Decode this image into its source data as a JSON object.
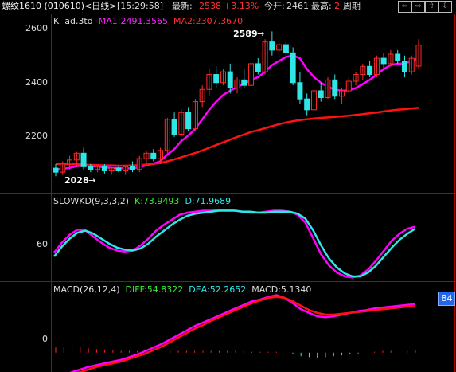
{
  "topbar": {
    "title": "螺纹1610 (010610)<日线>",
    "time": "[15:29:58]",
    "latest_label": "最新:",
    "latest_value": "2538",
    "change": "+3.13%",
    "open_label": "今开:",
    "open_value": "2461",
    "high_label": "最高:",
    "high_value": "2",
    "period": "周期"
  },
  "colors": {
    "up": "#ff2a2a",
    "down": "#2ee6e6",
    "ma1": "#ff00ff",
    "ma2": "#ff1111",
    "green": "#33ee33",
    "axis": "#b00000"
  },
  "main_header": {
    "k_label": "K",
    "adj": "ad.3td",
    "ma1": "MA1:2491.3565",
    "ma2": "MA2:2307.3670"
  },
  "main_axis": [
    "2600",
    "2400",
    "2200"
  ],
  "annotations": {
    "high": "2589",
    "low": "2028"
  },
  "kd_header": {
    "name": "SLOWKD(9,3,3,2)",
    "k": "K:73.9493",
    "d": "D:71.9689"
  },
  "kd_axis": [
    "60"
  ],
  "macd_header": {
    "name": "MACD(26,12,4)",
    "diff": "DIFF:54.8322",
    "dea": "DEA:52.2652",
    "macd": "MACD:5.1340"
  },
  "macd_axis": [
    "0"
  ],
  "badge": "84",
  "chart_data": {
    "type": "candlestick",
    "price_range": [
      2000,
      2640
    ],
    "candles": [
      {
        "o": 2085,
        "h": 2100,
        "l": 2055,
        "c": 2070
      },
      {
        "o": 2070,
        "h": 2110,
        "l": 2060,
        "c": 2100
      },
      {
        "o": 2100,
        "h": 2130,
        "l": 2080,
        "c": 2115
      },
      {
        "o": 2115,
        "h": 2145,
        "l": 2090,
        "c": 2140
      },
      {
        "o": 2140,
        "h": 2160,
        "l": 2080,
        "c": 2090
      },
      {
        "o": 2090,
        "h": 2100,
        "l": 2070,
        "c": 2080
      },
      {
        "o": 2080,
        "h": 2095,
        "l": 2070,
        "c": 2090
      },
      {
        "o": 2090,
        "h": 2100,
        "l": 2065,
        "c": 2075
      },
      {
        "o": 2075,
        "h": 2090,
        "l": 2060,
        "c": 2085
      },
      {
        "o": 2085,
        "h": 2090,
        "l": 2070,
        "c": 2075
      },
      {
        "o": 2075,
        "h": 2095,
        "l": 2060,
        "c": 2090
      },
      {
        "o": 2090,
        "h": 2110,
        "l": 2070,
        "c": 2080
      },
      {
        "o": 2080,
        "h": 2130,
        "l": 2070,
        "c": 2120
      },
      {
        "o": 2120,
        "h": 2150,
        "l": 2100,
        "c": 2140
      },
      {
        "o": 2140,
        "h": 2155,
        "l": 2110,
        "c": 2120
      },
      {
        "o": 2120,
        "h": 2160,
        "l": 2100,
        "c": 2150
      },
      {
        "o": 2150,
        "h": 2270,
        "l": 2140,
        "c": 2265
      },
      {
        "o": 2265,
        "h": 2290,
        "l": 2200,
        "c": 2210
      },
      {
        "o": 2210,
        "h": 2300,
        "l": 2200,
        "c": 2290
      },
      {
        "o": 2290,
        "h": 2310,
        "l": 2220,
        "c": 2230
      },
      {
        "o": 2230,
        "h": 2340,
        "l": 2220,
        "c": 2330
      },
      {
        "o": 2330,
        "h": 2390,
        "l": 2310,
        "c": 2375
      },
      {
        "o": 2375,
        "h": 2450,
        "l": 2350,
        "c": 2430
      },
      {
        "o": 2430,
        "h": 2460,
        "l": 2380,
        "c": 2400
      },
      {
        "o": 2400,
        "h": 2450,
        "l": 2390,
        "c": 2440
      },
      {
        "o": 2440,
        "h": 2470,
        "l": 2360,
        "c": 2380
      },
      {
        "o": 2380,
        "h": 2420,
        "l": 2360,
        "c": 2410
      },
      {
        "o": 2410,
        "h": 2450,
        "l": 2380,
        "c": 2390
      },
      {
        "o": 2390,
        "h": 2480,
        "l": 2380,
        "c": 2470
      },
      {
        "o": 2470,
        "h": 2490,
        "l": 2430,
        "c": 2440
      },
      {
        "o": 2440,
        "h": 2560,
        "l": 2430,
        "c": 2550
      },
      {
        "o": 2550,
        "h": 2589,
        "l": 2500,
        "c": 2520
      },
      {
        "o": 2520,
        "h": 2560,
        "l": 2490,
        "c": 2540
      },
      {
        "o": 2540,
        "h": 2550,
        "l": 2500,
        "c": 2510
      },
      {
        "o": 2510,
        "h": 2530,
        "l": 2390,
        "c": 2400
      },
      {
        "o": 2400,
        "h": 2440,
        "l": 2320,
        "c": 2340
      },
      {
        "o": 2340,
        "h": 2360,
        "l": 2280,
        "c": 2300
      },
      {
        "o": 2300,
        "h": 2380,
        "l": 2280,
        "c": 2370
      },
      {
        "o": 2370,
        "h": 2400,
        "l": 2330,
        "c": 2345
      },
      {
        "o": 2345,
        "h": 2420,
        "l": 2340,
        "c": 2410
      },
      {
        "o": 2410,
        "h": 2430,
        "l": 2340,
        "c": 2350
      },
      {
        "o": 2350,
        "h": 2380,
        "l": 2320,
        "c": 2370
      },
      {
        "o": 2370,
        "h": 2420,
        "l": 2360,
        "c": 2405
      },
      {
        "o": 2405,
        "h": 2440,
        "l": 2390,
        "c": 2430
      },
      {
        "o": 2430,
        "h": 2470,
        "l": 2410,
        "c": 2460
      },
      {
        "o": 2460,
        "h": 2480,
        "l": 2420,
        "c": 2430
      },
      {
        "o": 2430,
        "h": 2500,
        "l": 2420,
        "c": 2490
      },
      {
        "o": 2490,
        "h": 2510,
        "l": 2450,
        "c": 2470
      },
      {
        "o": 2470,
        "h": 2520,
        "l": 2460,
        "c": 2505
      },
      {
        "o": 2505,
        "h": 2520,
        "l": 2470,
        "c": 2480
      },
      {
        "o": 2480,
        "h": 2500,
        "l": 2420,
        "c": 2440
      },
      {
        "o": 2440,
        "h": 2500,
        "l": 2430,
        "c": 2490
      },
      {
        "o": 2461,
        "h": 2560,
        "l": 2450,
        "c": 2538
      }
    ],
    "ma1": [
      2080,
      2082,
      2086,
      2092,
      2095,
      2093,
      2090,
      2088,
      2086,
      2085,
      2084,
      2084,
      2088,
      2095,
      2102,
      2110,
      2135,
      2155,
      2185,
      2205,
      2230,
      2265,
      2300,
      2330,
      2355,
      2370,
      2385,
      2395,
      2410,
      2420,
      2440,
      2465,
      2480,
      2495,
      2500,
      2490,
      2450,
      2420,
      2400,
      2385,
      2375,
      2370,
      2372,
      2380,
      2395,
      2410,
      2430,
      2450,
      2465,
      2470,
      2470,
      2480,
      2491
    ],
    "ma2": [
      2100,
      2100,
      2100,
      2099,
      2098,
      2097,
      2096,
      2095,
      2095,
      2094,
      2094,
      2095,
      2096,
      2098,
      2101,
      2104,
      2110,
      2117,
      2125,
      2133,
      2141,
      2150,
      2160,
      2170,
      2180,
      2190,
      2200,
      2209,
      2218,
      2225,
      2232,
      2240,
      2247,
      2253,
      2258,
      2262,
      2265,
      2268,
      2270,
      2272,
      2274,
      2276,
      2278,
      2281,
      2284,
      2287,
      2290,
      2294,
      2297,
      2300,
      2302,
      2305,
      2307
    ],
    "kd_range": [
      20,
      100
    ],
    "k": [
      48,
      58,
      66,
      71,
      70,
      64,
      58,
      53,
      50,
      49,
      50,
      55,
      62,
      70,
      76,
      81,
      86,
      88,
      89,
      90,
      90,
      91,
      91,
      90,
      89,
      88,
      88,
      89,
      90,
      90,
      89,
      86,
      78,
      62,
      46,
      35,
      28,
      24,
      23,
      25,
      31,
      40,
      50,
      60,
      67,
      72,
      74
    ],
    "d": [
      44,
      54,
      62,
      68,
      70,
      67,
      62,
      57,
      53,
      51,
      50,
      52,
      57,
      64,
      70,
      76,
      81,
      85,
      87,
      88,
      89,
      90,
      90,
      90,
      89,
      89,
      88,
      88,
      89,
      89,
      89,
      87,
      82,
      70,
      55,
      42,
      33,
      27,
      24,
      24,
      28,
      35,
      44,
      53,
      61,
      67,
      72
    ],
    "macd_range": [
      -20,
      70
    ],
    "diff": [
      -28,
      -25,
      -22,
      -19,
      -16,
      -14,
      -12,
      -10,
      -8,
      -5,
      -2,
      2,
      6,
      10,
      15,
      20,
      25,
      30,
      34,
      38,
      42,
      46,
      50,
      54,
      58,
      60,
      63,
      65,
      62,
      56,
      49,
      45,
      41,
      40,
      41,
      43,
      45,
      47,
      48,
      50,
      51,
      52,
      53,
      54,
      55
    ],
    "dea": [
      -30,
      -28,
      -25,
      -22,
      -19,
      -16,
      -14,
      -12,
      -10,
      -7,
      -4,
      -1,
      3,
      7,
      12,
      17,
      22,
      27,
      31,
      36,
      40,
      44,
      48,
      52,
      56,
      59,
      62,
      63,
      62,
      58,
      53,
      48,
      45,
      43,
      43,
      44,
      45,
      46,
      47,
      48,
      49,
      50,
      51,
      52,
      52
    ],
    "macd_bars": [
      6,
      7,
      7,
      6,
      5,
      4,
      3,
      3,
      2,
      2,
      2,
      2,
      2,
      2,
      2,
      2,
      2,
      2,
      2,
      2,
      2,
      2,
      2,
      2,
      1,
      1,
      1,
      1,
      0,
      -2,
      -4,
      -5,
      -6,
      -5,
      -4,
      -3,
      -2,
      -1,
      0,
      1,
      2,
      2,
      2,
      2,
      3
    ]
  }
}
